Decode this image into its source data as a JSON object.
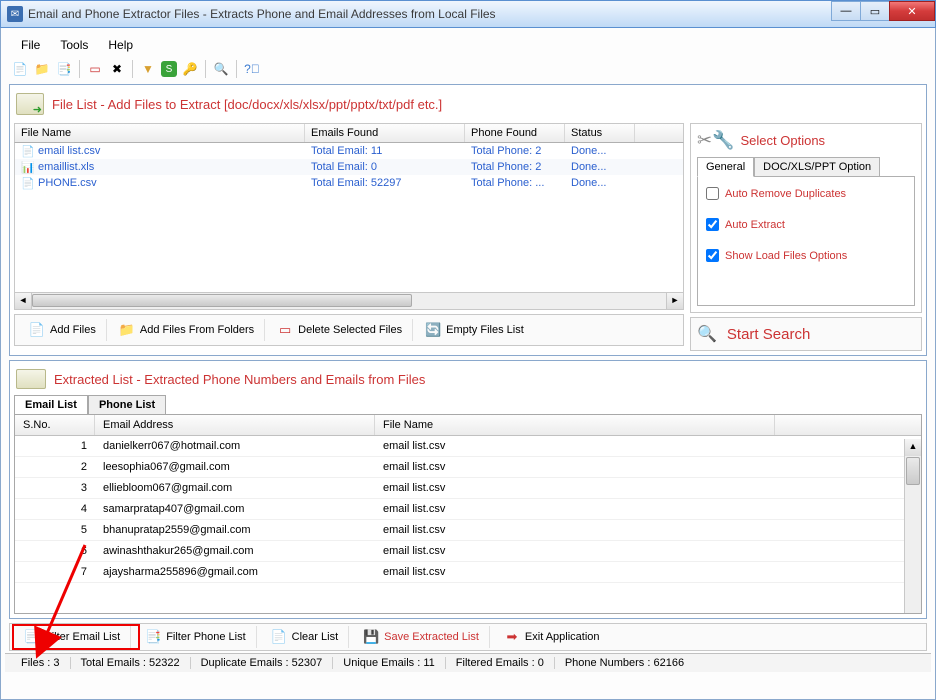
{
  "window": {
    "title": "Email and Phone Extractor Files  -  Extracts Phone and Email Addresses from Local Files"
  },
  "menu": {
    "file": "File",
    "tools": "Tools",
    "help": "Help"
  },
  "file_list": {
    "title": "File List - Add Files to Extract  [doc/docx/xls/xlsx/ppt/pptx/txt/pdf etc.]",
    "columns": {
      "fname": "File Name",
      "emails": "Emails Found",
      "phones": "Phone Found",
      "status": "Status"
    },
    "rows": [
      {
        "fname": "email list.csv",
        "emails": "Total Email: 11",
        "phones": "Total Phone: 2",
        "status": "Done..."
      },
      {
        "fname": "emaillist.xls",
        "emails": "Total Email: 0",
        "phones": "Total Phone: 2",
        "status": "Done..."
      },
      {
        "fname": "PHONE.csv",
        "emails": "Total Email: 52297",
        "phones": "Total Phone: ...",
        "status": "Done..."
      }
    ],
    "actions": {
      "add": "Add Files",
      "add_folders": "Add Files From Folders",
      "delete": "Delete Selected Files",
      "empty": "Empty Files List"
    }
  },
  "options": {
    "title": "Select Options",
    "tabs": {
      "general": "General",
      "doc": "DOC/XLS/PPT Option"
    },
    "auto_remove": "Auto Remove Duplicates",
    "auto_extract": "Auto Extract",
    "show_load": "Show Load Files Options",
    "start_search": "Start Search"
  },
  "extracted": {
    "title": "Extracted List - Extracted Phone Numbers and Emails from Files",
    "tabs": {
      "email": "Email List",
      "phone": "Phone List"
    },
    "columns": {
      "sno": "S.No.",
      "email": "Email Address",
      "fname": "File Name"
    },
    "rows": [
      {
        "sno": "1",
        "email": "danielkerr067@hotmail.com",
        "fname": "email list.csv"
      },
      {
        "sno": "2",
        "email": "leesophia067@gmail.com",
        "fname": "email list.csv"
      },
      {
        "sno": "3",
        "email": "elliebloom067@gmail.com",
        "fname": "email list.csv"
      },
      {
        "sno": "4",
        "email": "samarpratap407@gmail.com",
        "fname": "email list.csv"
      },
      {
        "sno": "5",
        "email": "bhanupratap2559@gmail.com",
        "fname": "email list.csv"
      },
      {
        "sno": "6",
        "email": "awinashthakur265@gmail.com",
        "fname": "email list.csv"
      },
      {
        "sno": "7",
        "email": "ajaysharma255896@gmail.com",
        "fname": "email list.csv"
      }
    ]
  },
  "bottom": {
    "filter_email": "Filter Email List",
    "filter_phone": "Filter Phone List",
    "clear": "Clear List",
    "save": "Save Extracted List",
    "exit": "Exit Application"
  },
  "status": {
    "files": "Files :  3",
    "total": "Total Emails :  52322",
    "dup": "Duplicate Emails :  52307",
    "unique": "Unique Emails :  11",
    "filtered": "Filtered Emails :  0",
    "phones": "Phone Numbers :   62166"
  }
}
